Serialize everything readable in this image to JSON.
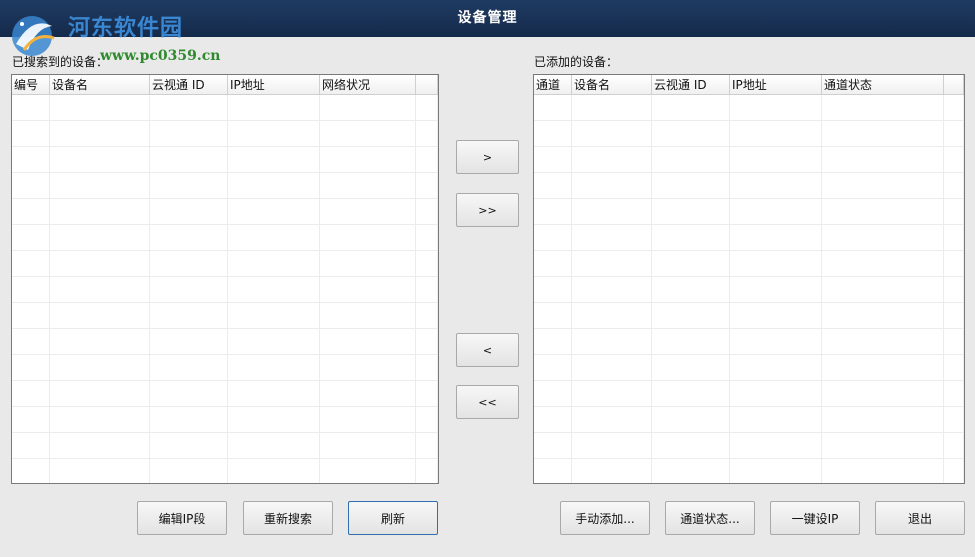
{
  "window": {
    "title": "设备管理"
  },
  "watermark": {
    "name": "河东软件园",
    "url": "www.pc0359.cn"
  },
  "searched": {
    "label": "已搜索到的设备：",
    "columns": [
      "编号",
      "设备名",
      "云视通 ID",
      "IP地址",
      "网络状况"
    ]
  },
  "added": {
    "label": "已添加的设备：",
    "columns": [
      "通道",
      "设备名",
      "云视通 ID",
      "IP地址",
      "通道状态"
    ]
  },
  "transfer": {
    "add_one": ">",
    "add_all": ">>",
    "remove_one": "<",
    "remove_all": "<<"
  },
  "left_buttons": {
    "edit_ip": "编辑IP段",
    "research": "重新搜索",
    "refresh": "刷新"
  },
  "right_buttons": {
    "manual_add": "手动添加...",
    "channel_status": "通道状态...",
    "one_key_ip": "一键设IP",
    "exit": "退出"
  },
  "colors": {
    "titlebar": "#1f3b63",
    "background": "#e9e9e9",
    "focus_border": "#2f6fb0"
  }
}
